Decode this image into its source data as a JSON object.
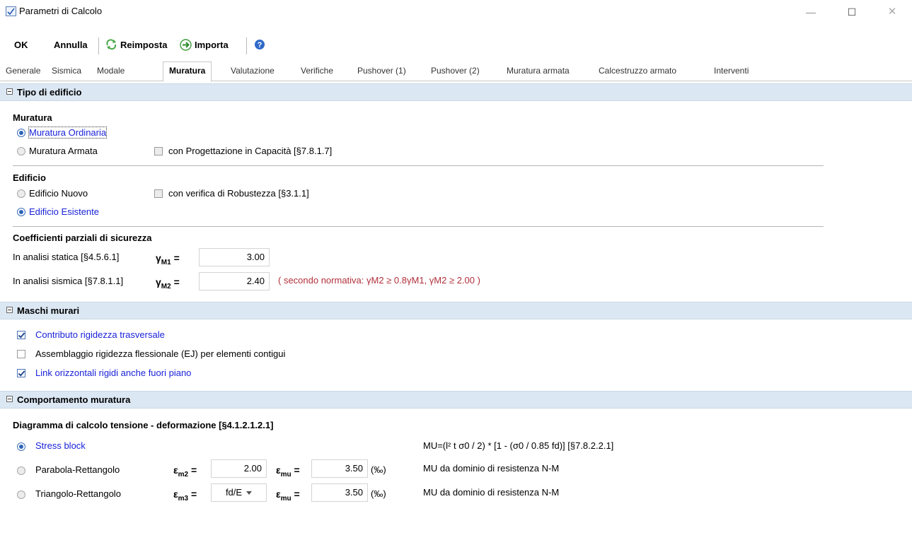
{
  "window": {
    "title": "Parametri di Calcolo"
  },
  "toolbar": {
    "ok": "OK",
    "annulla": "Annulla",
    "reimposta": "Reimposta",
    "importa": "Importa"
  },
  "tabs": [
    "Generale",
    "Sismica",
    "Modale",
    "Muratura",
    "Valutazione",
    "Verifiche",
    "Pushover (1)",
    "Pushover (2)",
    "Muratura armata",
    "Calcestruzzo armato",
    "Interventi"
  ],
  "active_tab": "Muratura",
  "tipo_edificio": {
    "header": "Tipo di edificio",
    "muratura": {
      "label": "Muratura",
      "opt1": "Muratura Ordinaria",
      "opt2": "Muratura Armata",
      "check": "con Progettazione in Capacità [§7.8.1.7]"
    },
    "edificio": {
      "label": "Edificio",
      "opt1": "Edificio Nuovo",
      "opt2": "Edificio Esistente",
      "check": "con verifica di Robustezza [§3.1.1]"
    },
    "coeff": {
      "label": "Coefficienti parziali di sicurezza",
      "statica_label": "In analisi statica [§4.5.6.1]",
      "statica_sym": "γ",
      "statica_sub": "M1",
      "statica_value": "3.00",
      "sismica_label": "In analisi sismica [§7.8.1.1]",
      "sismica_sym": "γ",
      "sismica_sub": "M2",
      "sismica_value": "2.40",
      "note": "( secondo normativa: γM2 ≥ 0.8γM1, γM2 ≥ 2.00 )"
    }
  },
  "maschi": {
    "header": "Maschi murari",
    "c1": "Contributo rigidezza trasversale",
    "c2": "Assemblaggio rigidezza flessionale (EJ) per elementi contigui",
    "c3": "Link orizzontali rigidi anche fuori piano"
  },
  "comportamento": {
    "header": "Comportamento muratura",
    "diagram_label": "Diagramma di calcolo tensione - deformazione [§4.1.2.1.2.1]",
    "stress_block": "Stress block",
    "stress_formula": "MU=(l² t σ0 / 2) * [1 - (σ0 / 0.85 fd)]   [§7.8.2.2.1]",
    "parabola": "Parabola-Rettangolo",
    "em2_sym": "ε",
    "em2_sub": "m2",
    "em2_value": "2.00",
    "emu_sym": "ε",
    "emu_sub": "mu",
    "emu1_value": "3.50",
    "permille": "(‰)",
    "mu_dominio": "MU da dominio di resistenza N-M",
    "triangolo": "Triangolo-Rettangolo",
    "em3_sym": "ε",
    "em3_sub": "m3",
    "em3_value": "fd/E",
    "emu2_value": "3.50"
  }
}
